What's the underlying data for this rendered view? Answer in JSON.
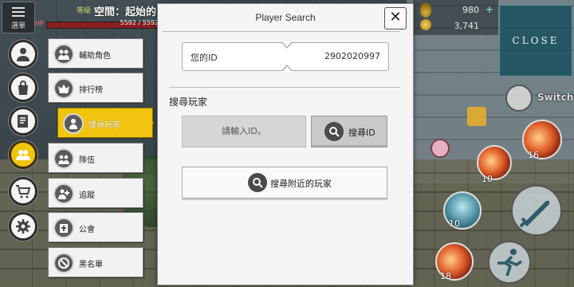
{
  "hud": {
    "menu_label": "選單",
    "level_text": "等級 1級",
    "zone_text": "空間：起始的",
    "hp_label": "HP",
    "hp_value": "5592 / 5592"
  },
  "currency": {
    "potion_count": "980",
    "gold": "3,741",
    "plus": "+"
  },
  "close_big": "CLOSE",
  "left_menu": [
    {
      "name": "profile",
      "icon": "person-icon"
    },
    {
      "name": "shop",
      "icon": "bag-icon"
    },
    {
      "name": "quest",
      "icon": "notepad-icon"
    },
    {
      "name": "social",
      "icon": "people-icon",
      "active": true
    },
    {
      "name": "store",
      "icon": "cart-icon"
    },
    {
      "name": "settings",
      "icon": "gear-icon"
    }
  ],
  "social_menu": [
    {
      "label": "輔助角色",
      "icon": "helper-icon"
    },
    {
      "label": "排行榜",
      "icon": "crown-icon"
    },
    {
      "label": "搜尋玩家",
      "icon": "search-player-icon",
      "active": true
    },
    {
      "label": "隊伍",
      "icon": "party-icon"
    },
    {
      "label": "追蹤",
      "icon": "follow-icon"
    },
    {
      "label": "公會",
      "icon": "guild-icon"
    },
    {
      "label": "黑名單",
      "icon": "block-icon"
    }
  ],
  "dialog": {
    "title": "Player Search",
    "close": "✕",
    "my_id_label": "您的ID",
    "my_id_value": "2902020997",
    "section_label": "搜尋玩家",
    "id_input_placeholder": "請輸入ID。",
    "search_id_label": "搜尋ID",
    "nearby_label": "搜尋附近的玩家"
  },
  "skills": {
    "switch_label": "Switch",
    "num_a": "16",
    "num_b": "10",
    "num_c": "10",
    "num_d": "18"
  },
  "colors": {
    "active": "#f1c40f",
    "close_panel": "#195060"
  }
}
